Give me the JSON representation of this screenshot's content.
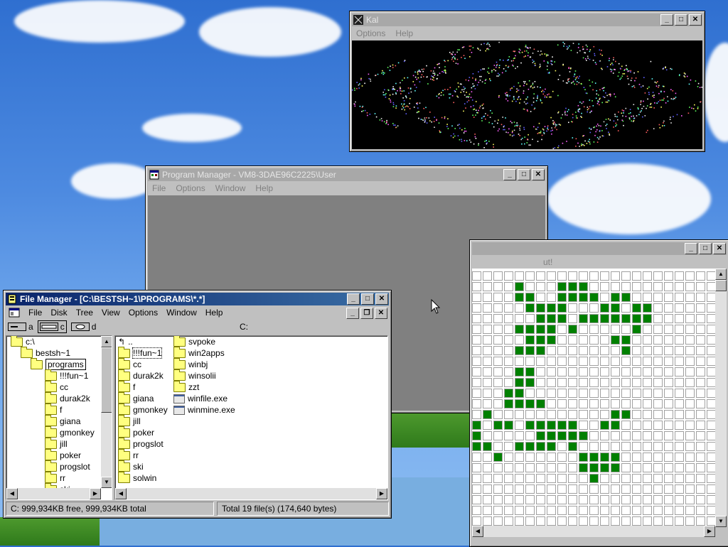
{
  "colors": {
    "active_title": "#0a246a",
    "inactive_title": "#a8a8a8",
    "cell_alive": "#008000",
    "mdi_bg": "#808080"
  },
  "kal": {
    "title": "Kal",
    "menu": [
      "Options",
      "Help"
    ]
  },
  "program_manager": {
    "title": "Program Manager - VM8-3DAE96C2225\\User",
    "menu": [
      "File",
      "Options",
      "Window",
      "Help"
    ]
  },
  "life": {
    "partial_title": "ut!"
  },
  "file_manager": {
    "title": "File Manager - [C:\\BESTSH~1\\PROGRAMS\\*.*]",
    "menu": [
      "File",
      "Disk",
      "Tree",
      "View",
      "Options",
      "Window",
      "Help"
    ],
    "drives": [
      "a",
      "c",
      "d"
    ],
    "current_drive_label": "C:",
    "tree": [
      "c:\\",
      "bestsh~1",
      "programs",
      "!!!fun~1",
      "cc",
      "durak2k",
      "f",
      "giana",
      "gmonkey",
      "jill",
      "poker",
      "progslot",
      "rr",
      "ski"
    ],
    "files_col1": [
      "..",
      "!!!fun~1",
      "cc",
      "durak2k",
      "f",
      "giana",
      "gmonkey",
      "jill",
      "poker",
      "progslot",
      "rr",
      "ski",
      "solwin"
    ],
    "files_col2": [
      "svpoke",
      "win2apps",
      "winbj",
      "winsolii",
      "zzt",
      "winfile.exe",
      "winmine.exe"
    ],
    "status_left": "C: 999,934KB free,  999,934KB total",
    "status_right": "Total 19 file(s) (174,640 bytes)"
  },
  "controls": {
    "minimize": "_",
    "maximize": "□",
    "close": "✕",
    "restore": "❐"
  }
}
